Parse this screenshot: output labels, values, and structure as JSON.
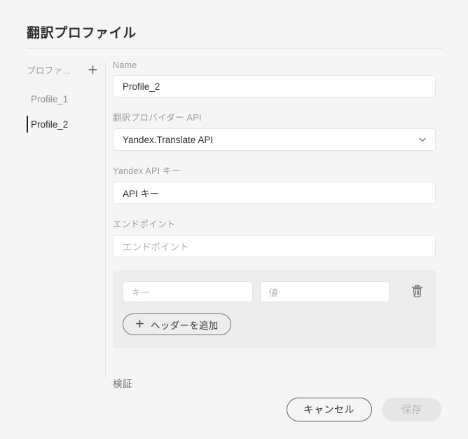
{
  "window": {
    "title": "翻訳プロファイル"
  },
  "sidebar": {
    "header_label": "プロファ...",
    "add_icon": "plus-icon",
    "items": [
      {
        "label": "Profile_1",
        "selected": false
      },
      {
        "label": "Profile_2",
        "selected": true
      }
    ]
  },
  "form": {
    "name": {
      "label": "Name",
      "value": "Profile_2",
      "placeholder": "Name"
    },
    "provider": {
      "label": "翻訳プロバイダー API",
      "value": "Yandex.Translate API",
      "icon": "chevron-down-icon",
      "options": [
        "Yandex.Translate API"
      ]
    },
    "api_key": {
      "label": "Yandex API キー",
      "value": "API キー",
      "placeholder": "API キー"
    },
    "endpoint": {
      "label": "エンドポイント",
      "value": "",
      "placeholder": "エンドポイント"
    },
    "headers": {
      "rows": [
        {
          "key_value": "",
          "key_placeholder": "キー",
          "val_value": "",
          "val_placeholder": "値",
          "delete_icon": "trash-icon"
        }
      ],
      "add_button": {
        "label": "ヘッダーを追加",
        "icon": "plus-icon"
      }
    },
    "validate_button": {
      "label": "検証"
    }
  },
  "footer": {
    "cancel_label": "キャンセル",
    "save_label": "保存",
    "save_disabled": true
  },
  "colors": {
    "page_background": "#f5f5f5",
    "panel_background": "#ededed",
    "input_background": "#ffffff",
    "border": "#e4e4e4",
    "text_primary": "#2f2f2f",
    "text_muted": "#9b9b9b",
    "placeholder": "#b6b6b6",
    "selection_indicator": "#222222",
    "save_disabled_bg": "#e6e6e6"
  }
}
